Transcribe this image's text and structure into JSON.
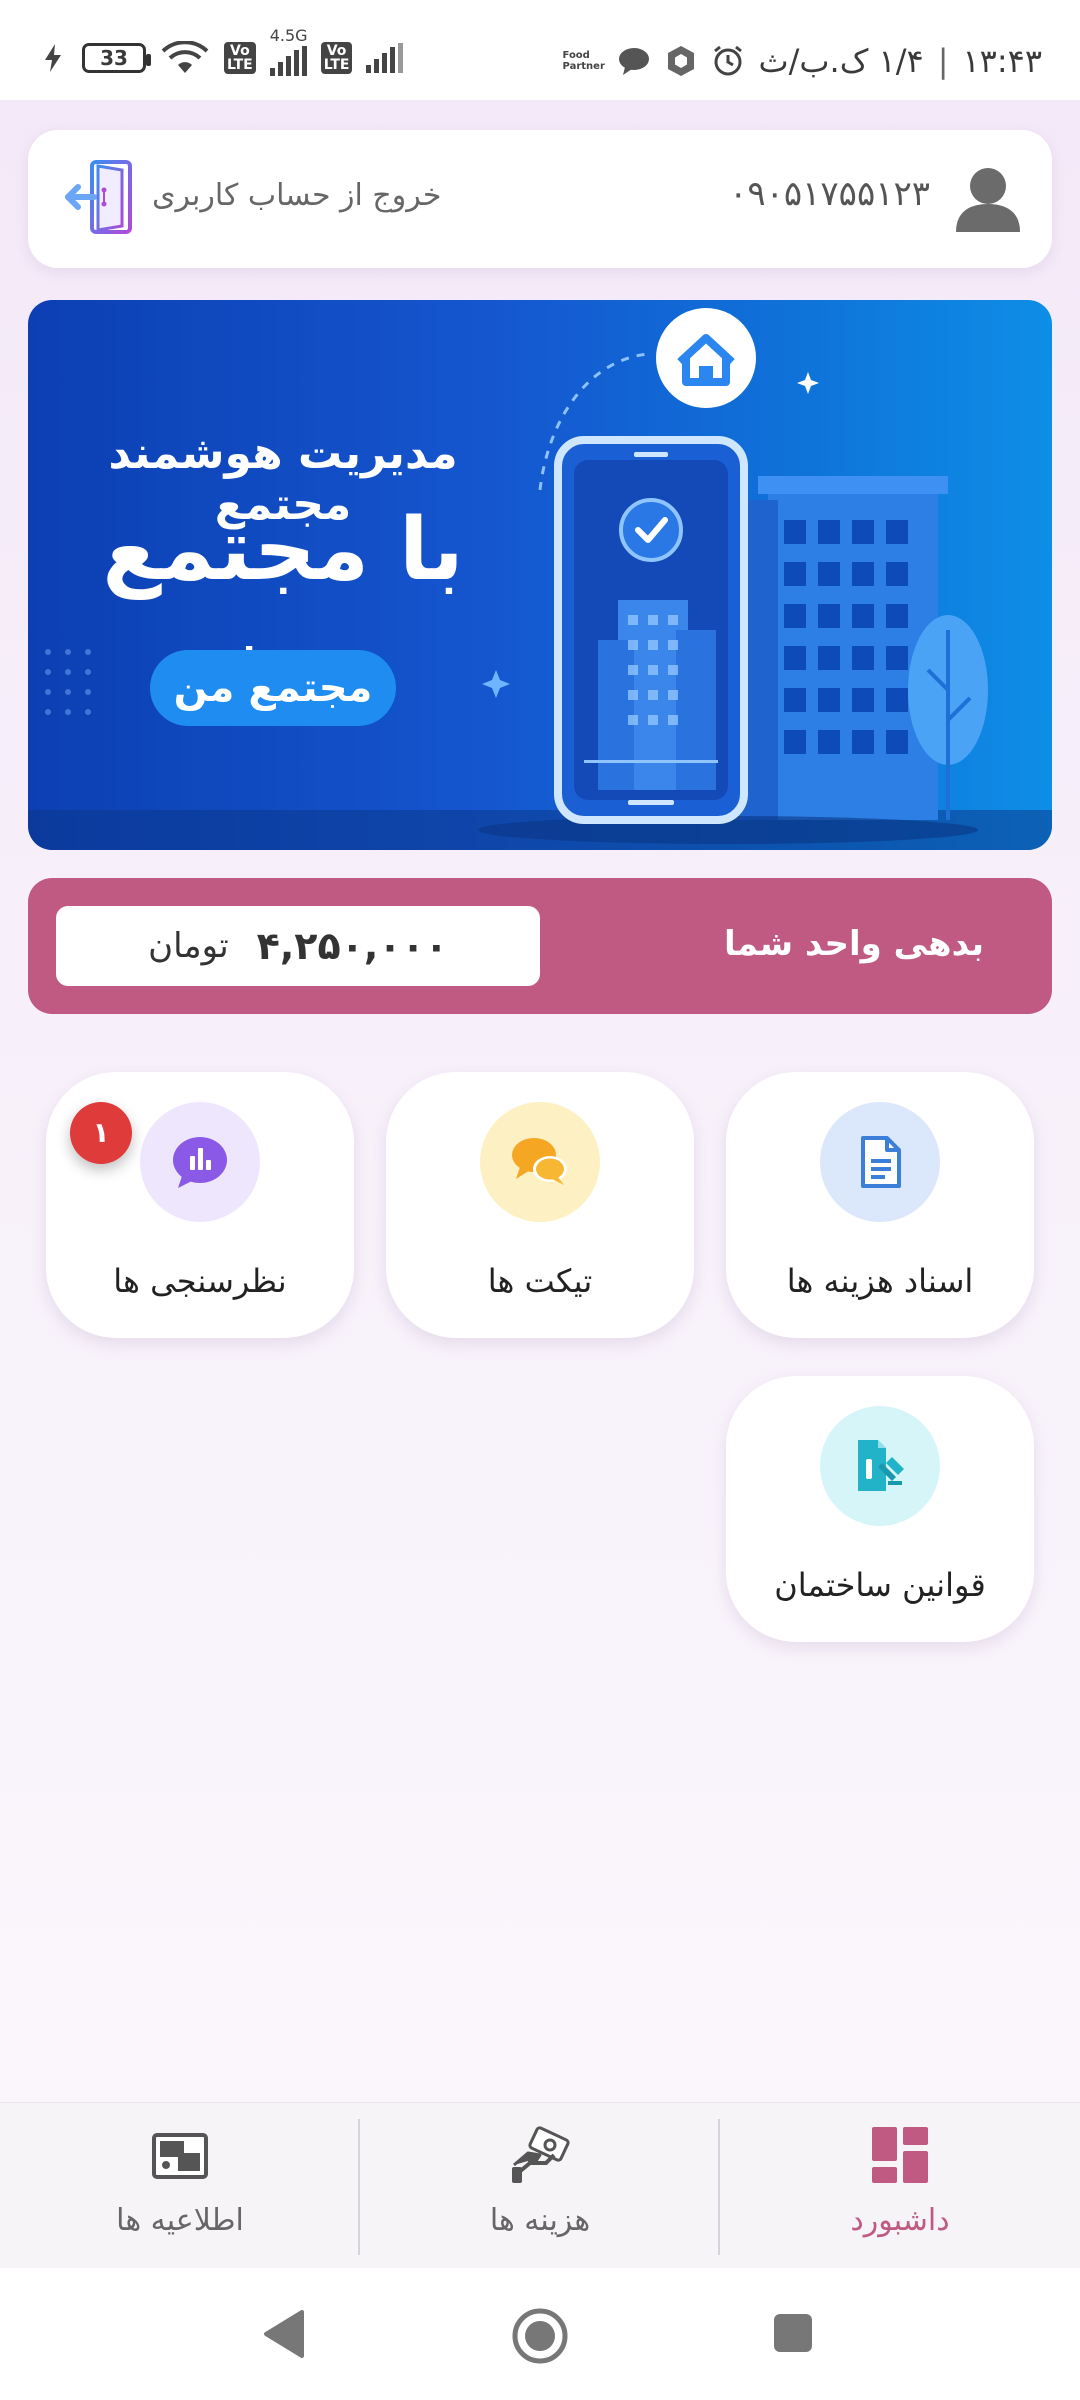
{
  "status_bar": {
    "time": "۱۳:۴۳",
    "date": "۱/۴ ک.ب/ث",
    "battery": "33",
    "network": "4.5G",
    "volte": "Vo LTE",
    "food_app": "Food Partner"
  },
  "account": {
    "phone": "۰۹۰۵۱۷۵۵۱۲۳",
    "logout_label": "خروج از حساب کاربری"
  },
  "banner": {
    "title_line1": "مدیریت هوشمند مجتمع",
    "title_line2": "با مجتمع من",
    "pill_label": "مجتمع من"
  },
  "debt": {
    "label": "بدهی واحد شما",
    "amount": "۴,۲۵۰,۰۰۰",
    "unit": "تومان"
  },
  "tiles": [
    {
      "label": "اسناد هزینه ها",
      "icon": "document-icon",
      "color": "#dbe8fb"
    },
    {
      "label": "تیکت ها",
      "icon": "chat-bubbles-icon",
      "color": "#fdf0c2"
    },
    {
      "label": "نظرسنجی ها",
      "icon": "poll-chart-icon",
      "color": "#eee6fc",
      "badge": "۱"
    },
    {
      "label": "قوانین ساختمان",
      "icon": "rules-document-icon",
      "color": "#d5f5f9"
    }
  ],
  "bottom_nav": [
    {
      "label": "داشبورد",
      "icon": "dashboard-icon",
      "active": true
    },
    {
      "label": "هزینه ها",
      "icon": "money-hand-icon",
      "active": false
    },
    {
      "label": "اطلاعیه ها",
      "icon": "announcement-icon",
      "active": false
    }
  ],
  "colors": {
    "accent": "#c05a83",
    "banner": "#1556cf"
  }
}
